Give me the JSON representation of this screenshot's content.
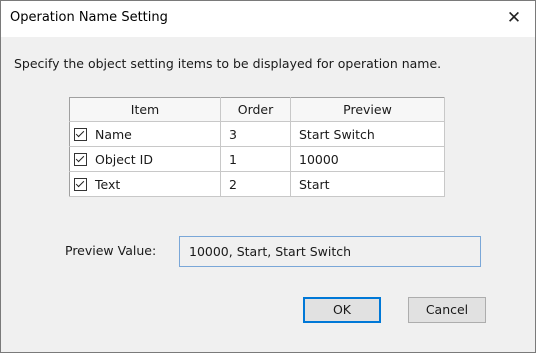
{
  "window": {
    "title": "Operation Name Setting",
    "close_glyph": "✕"
  },
  "instruction": "Specify the object setting items to be displayed for operation name.",
  "table": {
    "headers": [
      "Item",
      "Order",
      "Preview"
    ],
    "rows": [
      {
        "checked": true,
        "item": "Name",
        "order": "3",
        "preview": "Start Switch"
      },
      {
        "checked": true,
        "item": "Object ID",
        "order": "1",
        "preview": "10000"
      },
      {
        "checked": true,
        "item": "Text",
        "order": "2",
        "preview": "Start"
      }
    ]
  },
  "preview": {
    "label": "Preview Value:",
    "value": "10000, Start, Start Switch"
  },
  "buttons": {
    "ok": "OK",
    "cancel": "Cancel"
  },
  "colors": {
    "accent": "#0078d7",
    "dialog_bg": "#f0f0f0",
    "titlebar_bg": "#ffffff"
  }
}
